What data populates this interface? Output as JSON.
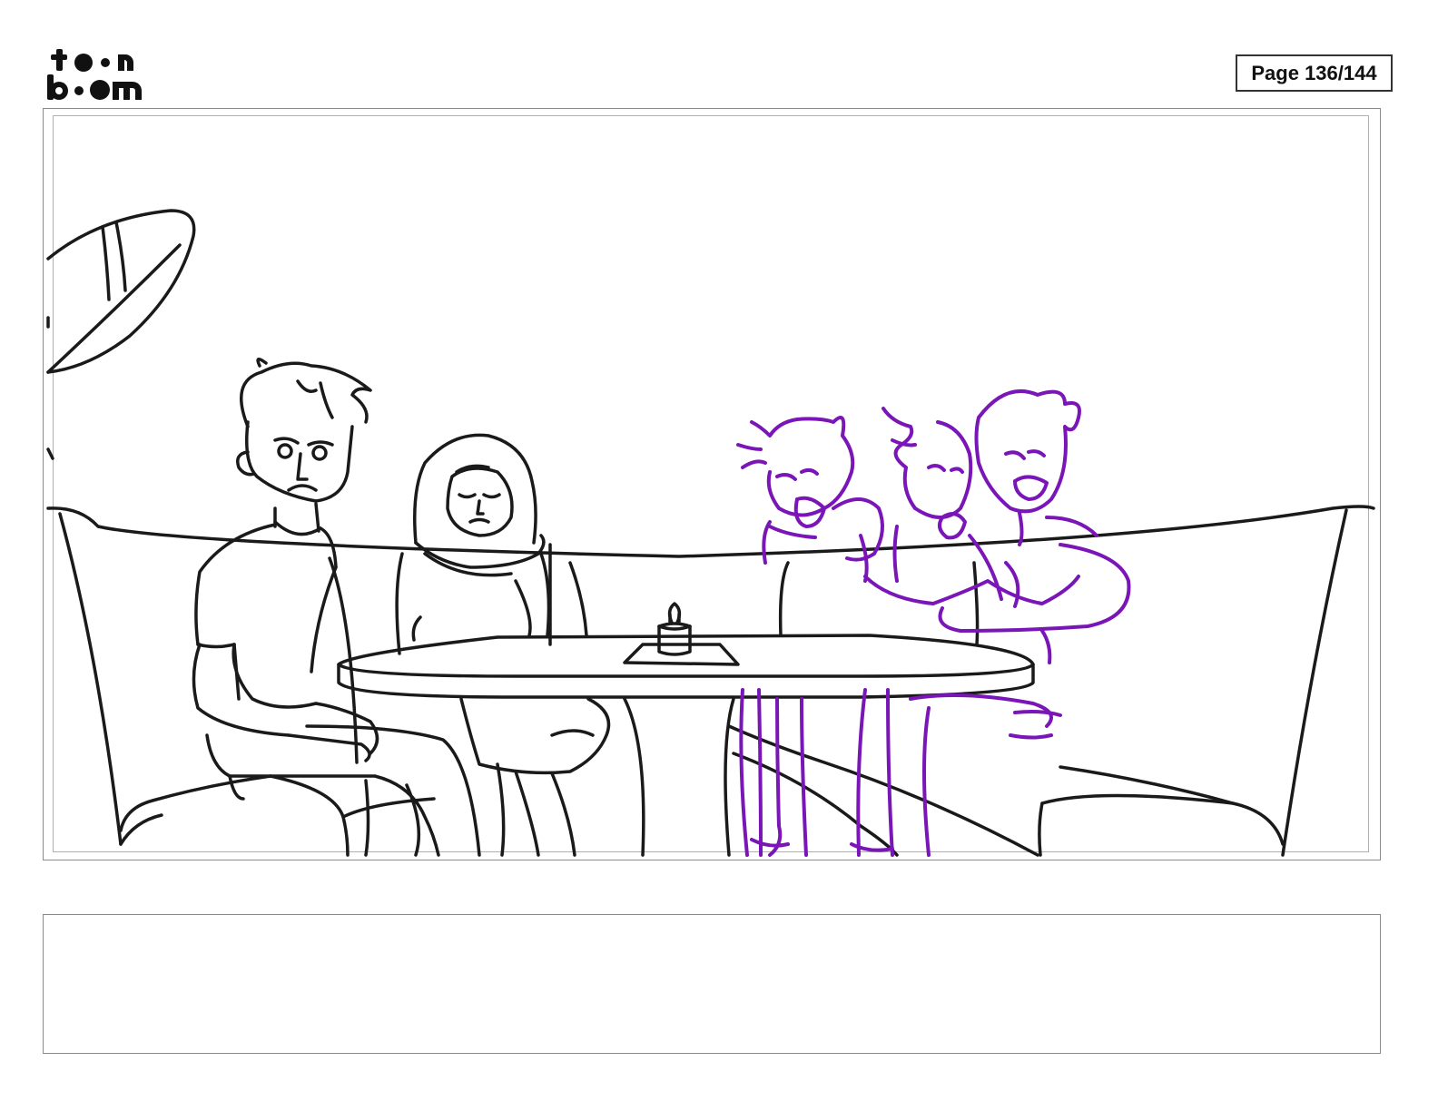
{
  "header": {
    "logo_word_top": "toon",
    "logo_word_bottom": "boom",
    "page_label": "Page 136/144"
  },
  "panel": {
    "colors": {
      "line": "#1a1a1a",
      "sketch": "#7a16b8",
      "frame": "#8a8a8a"
    }
  },
  "notes": {
    "text": ""
  }
}
